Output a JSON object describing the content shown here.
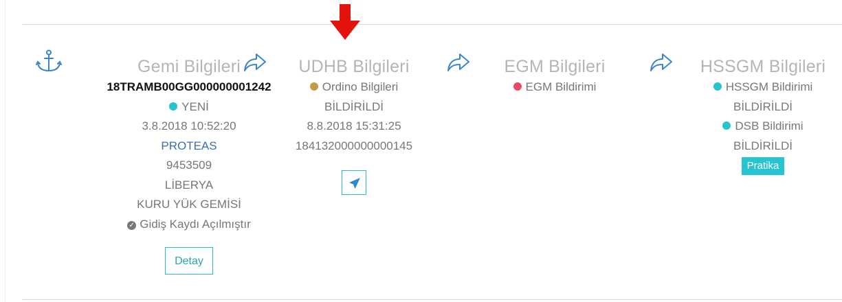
{
  "icons": {
    "anchor": "anchor-icon",
    "share": "share-icon",
    "send": "paper-plane-icon",
    "check": "check-circle-icon",
    "annotation": "red-down-arrow"
  },
  "colors": {
    "teal": "#26c4d1",
    "gold": "#c39a49",
    "red": "#e84a5f",
    "link_blue": "#3a6fb0",
    "annotation_red": "#e3120b"
  },
  "gemi": {
    "title": "Gemi Bilgileri",
    "ref_no": "18TRAMB00GG000000001242",
    "status": "YENİ",
    "date": "3.8.2018 10:52:20",
    "ship_name": "PROTEAS",
    "imo": "9453509",
    "flag": "LİBERYA",
    "type": "KURU YÜK GEMİSİ",
    "departure": "Gidiş Kaydı Açılmıştır",
    "detail_button": "Detay"
  },
  "udhb": {
    "title": "UDHB Bilgileri",
    "ordino": "Ordino Bilgileri",
    "status": "BİLDİRİLDİ",
    "date": "8.8.2018 15:31:25",
    "number": "184132000000000145"
  },
  "egm": {
    "title": "EGM Bilgileri",
    "notification": "EGM Bildirimi"
  },
  "hssgm": {
    "title": "HSSGM Bilgileri",
    "notification": "HSSGM Bildirimi",
    "notification_status": "BİLDİRİLDİ",
    "dsb": "DSB Bildirimi",
    "dsb_status": "BİLDİRİLDİ",
    "badge": "Pratika"
  }
}
